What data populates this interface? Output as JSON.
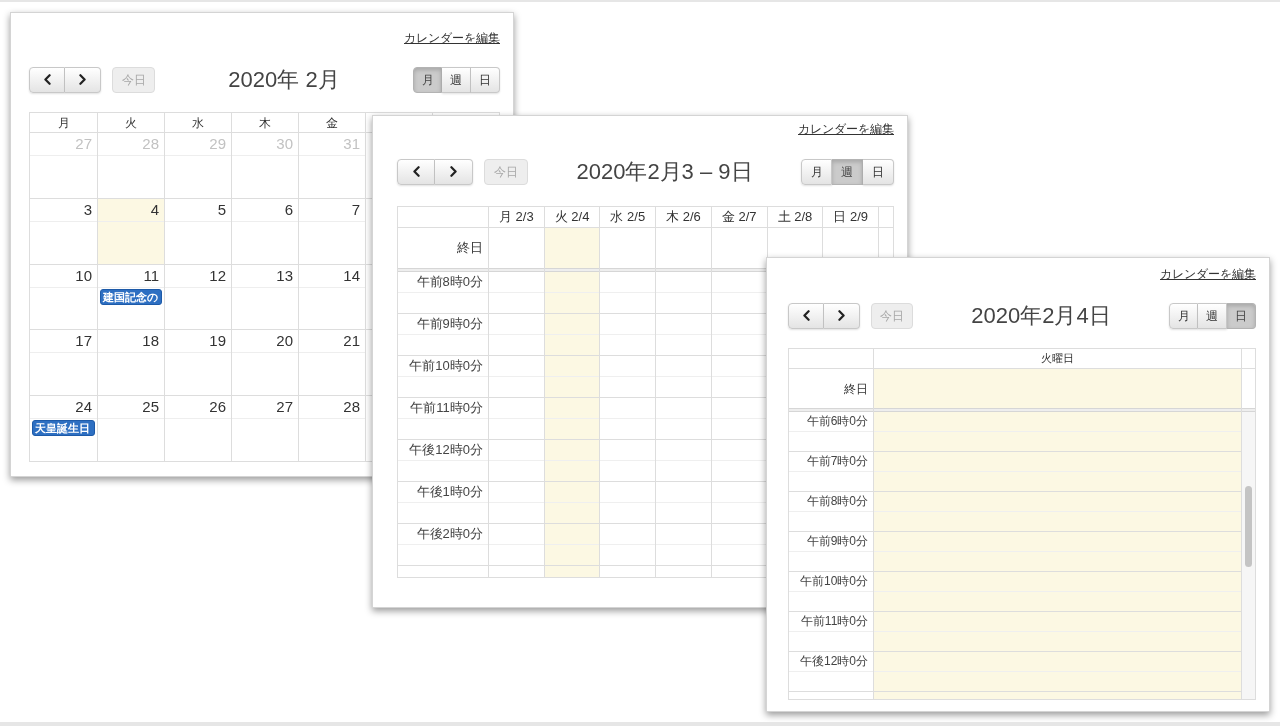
{
  "windows": [
    {
      "kind": "month",
      "edit_link": "カレンダーを編集",
      "today_button": {
        "label": "今日",
        "disabled": true
      },
      "title": "2020年 2月",
      "views": [
        {
          "label": "月",
          "selected": true
        },
        {
          "label": "週",
          "selected": false
        },
        {
          "label": "日",
          "selected": false
        }
      ],
      "weekdays": [
        "月",
        "火",
        "水",
        "木",
        "金"
      ],
      "weeks": [
        {
          "days": [
            {
              "number": "27",
              "other_month": true,
              "today": false
            },
            {
              "number": "28",
              "other_month": true,
              "today": false
            },
            {
              "number": "29",
              "other_month": true,
              "today": false
            },
            {
              "number": "30",
              "other_month": true,
              "today": false
            },
            {
              "number": "31",
              "other_month": true,
              "today": false
            }
          ]
        },
        {
          "days": [
            {
              "number": "3",
              "other_month": false,
              "today": false
            },
            {
              "number": "4",
              "other_month": false,
              "today": true
            },
            {
              "number": "5",
              "other_month": false,
              "today": false
            },
            {
              "number": "6",
              "other_month": false,
              "today": false
            },
            {
              "number": "7",
              "other_month": false,
              "today": false
            }
          ]
        },
        {
          "days": [
            {
              "number": "10",
              "other_month": false,
              "today": false
            },
            {
              "number": "11",
              "other_month": false,
              "today": false,
              "events": [
                {
                  "title": "建国記念の"
                }
              ]
            },
            {
              "number": "12",
              "other_month": false,
              "today": false
            },
            {
              "number": "13",
              "other_month": false,
              "today": false
            },
            {
              "number": "14",
              "other_month": false,
              "today": false
            }
          ]
        },
        {
          "days": [
            {
              "number": "17",
              "other_month": false,
              "today": false
            },
            {
              "number": "18",
              "other_month": false,
              "today": false
            },
            {
              "number": "19",
              "other_month": false,
              "today": false
            },
            {
              "number": "20",
              "other_month": false,
              "today": false
            },
            {
              "number": "21",
              "other_month": false,
              "today": false
            }
          ]
        },
        {
          "days": [
            {
              "number": "24",
              "other_month": false,
              "today": false,
              "events": [
                {
                  "title": "天皇誕生日"
                }
              ]
            },
            {
              "number": "25",
              "other_month": false,
              "today": false
            },
            {
              "number": "26",
              "other_month": false,
              "today": false
            },
            {
              "number": "27",
              "other_month": false,
              "today": false
            },
            {
              "number": "28",
              "other_month": false,
              "today": false
            }
          ]
        }
      ]
    },
    {
      "kind": "time_grid",
      "edit_link": "カレンダーを編集",
      "today_button": {
        "label": "今日",
        "disabled": true
      },
      "title": "2020年2月3 – 9日",
      "views": [
        {
          "label": "月",
          "selected": false
        },
        {
          "label": "週",
          "selected": true
        },
        {
          "label": "日",
          "selected": false
        }
      ],
      "columns": [
        {
          "label": "月 2/3",
          "today": false
        },
        {
          "label": "火 2/4",
          "today": true
        },
        {
          "label": "水 2/5",
          "today": false
        },
        {
          "label": "木 2/6",
          "today": false
        },
        {
          "label": "金 2/7",
          "today": false
        },
        {
          "label": "土 2/8",
          "today": false
        },
        {
          "label": "日 2/9",
          "today": false
        }
      ],
      "all_day_label": "終日",
      "time_slots": [
        "午前8時0分",
        "午前9時0分",
        "午前10時0分",
        "午前11時0分",
        "午後12時0分",
        "午後1時0分",
        "午後2時0分"
      ]
    },
    {
      "kind": "time_grid",
      "edit_link": "カレンダーを編集",
      "today_button": {
        "label": "今日",
        "disabled": true
      },
      "title": "2020年2月4日",
      "views": [
        {
          "label": "月",
          "selected": false
        },
        {
          "label": "週",
          "selected": false
        },
        {
          "label": "日",
          "selected": true
        }
      ],
      "columns": [
        {
          "label": "火曜日",
          "today": true
        }
      ],
      "all_day_label": "終日",
      "time_slots": [
        "午前6時0分",
        "午前7時0分",
        "午前8時0分",
        "午前9時0分",
        "午前10時0分",
        "午前11時0分",
        "午後12時0分"
      ]
    }
  ]
}
